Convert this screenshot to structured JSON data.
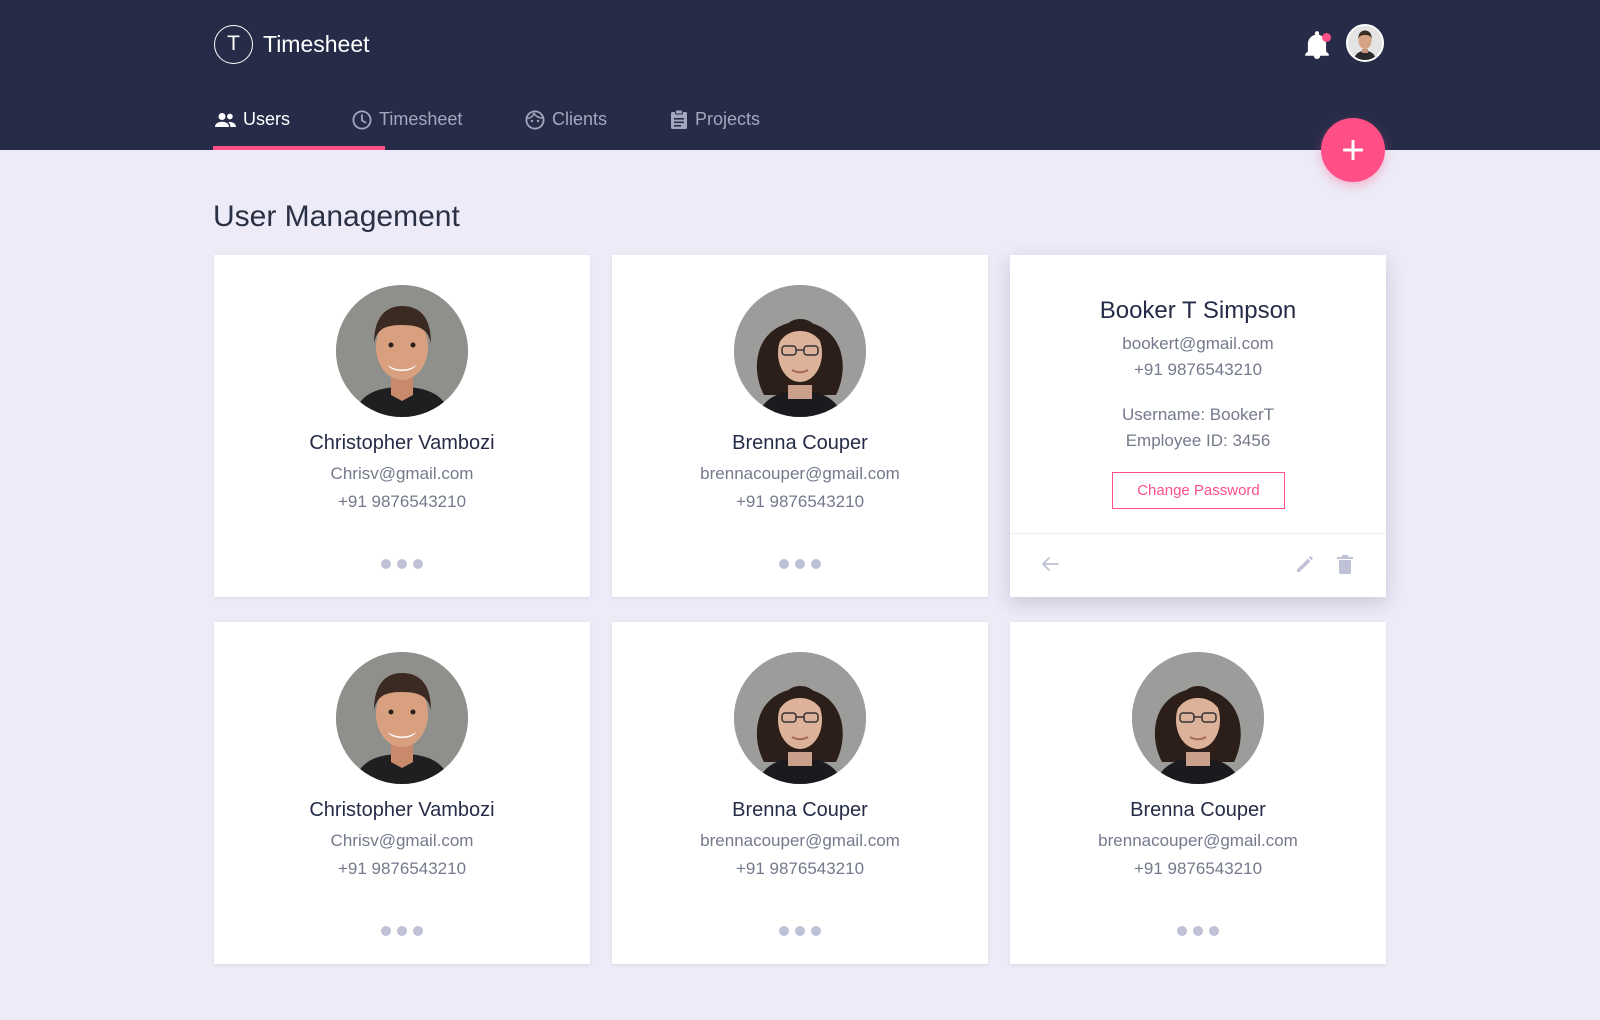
{
  "app": {
    "logo_letter": "T",
    "title": "Timesheet"
  },
  "nav": {
    "tabs": [
      {
        "label": "Users",
        "icon": "users-icon",
        "active": true
      },
      {
        "label": "Timesheet",
        "icon": "clock-icon",
        "active": false
      },
      {
        "label": "Clients",
        "icon": "face-icon",
        "active": false
      },
      {
        "label": "Projects",
        "icon": "clipboard-icon",
        "active": false
      }
    ]
  },
  "header": {
    "notification_icon": "bell-icon",
    "has_unread": true
  },
  "page": {
    "title": "User Management"
  },
  "users": [
    {
      "name": "Christopher Vambozi",
      "email": "Chrisv@gmail.com",
      "phone": "+91 9876543210",
      "avatar": "man-photo"
    },
    {
      "name": "Brenna Couper",
      "email": "brennacouper@gmail.com",
      "phone": "+91 9876543210",
      "avatar": "woman-photo"
    },
    {
      "name": "Booker T Simpson",
      "email": "bookert@gmail.com",
      "phone": "+91 9876543210",
      "username_text": "Username: BookerT",
      "employee_id_text": "Employee ID: 3456",
      "change_password_label": "Change Password",
      "expanded": true
    },
    {
      "name": "Christopher Vambozi",
      "email": "Chrisv@gmail.com",
      "phone": "+91 9876543210",
      "avatar": "man-photo"
    },
    {
      "name": "Brenna Couper",
      "email": "brennacouper@gmail.com",
      "phone": "+91 9876543210",
      "avatar": "woman-photo"
    },
    {
      "name": "Brenna Couper",
      "email": "brennacouper@gmail.com",
      "phone": "+91 9876543210",
      "avatar": "woman-photo"
    }
  ],
  "colors": {
    "header_bg": "#262c48",
    "accent": "#ff4f86",
    "page_bg": "#ecebf7",
    "muted_dots": "#bfc2d6"
  }
}
